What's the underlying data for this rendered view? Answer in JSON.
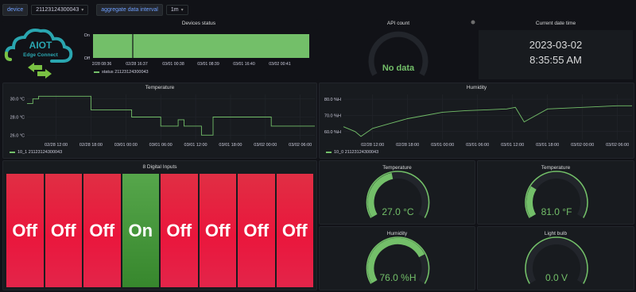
{
  "toolbar": {
    "device_label": "device",
    "device_value": "21123124300043",
    "interval_label": "aggregate data interval",
    "interval_value": "1m"
  },
  "logo": {
    "line1": "AIOT",
    "line2": "Edge Connect"
  },
  "devices_status": {
    "title": "Devices status",
    "y_top": "On",
    "y_bottom": "Off",
    "x_ticks": [
      "2/28 08:36",
      "02/28 16:37",
      "03/01 00:38",
      "03/01 08:39",
      "03/01 16:40",
      "03/02 00:41"
    ],
    "legend": "status 21123124300043",
    "chart_data": {
      "type": "bar",
      "title": "Devices status",
      "categories": [
        "2/28 08:36",
        "02/28 16:37",
        "03/01 00:38",
        "03/01 08:39",
        "03/01 16:40",
        "03/02 00:41"
      ],
      "series": [
        {
          "name": "status 21123124300043",
          "values": [
            1,
            1,
            1,
            1,
            1,
            1
          ]
        }
      ],
      "ylim": [
        0,
        1
      ]
    }
  },
  "api_count": {
    "title": "API count",
    "value": "No data"
  },
  "clock": {
    "title": "Current date time",
    "date": "2023-03-02",
    "time": "8:35:55 AM"
  },
  "temperature_chart": {
    "title": "Temperature",
    "y_ticks": [
      "30.0 °C",
      "28.0 °C",
      "26.0 °C"
    ],
    "x_ticks": [
      "02/28 12:00",
      "02/28 18:00",
      "03/01 00:00",
      "03/01 06:00",
      "03/01 12:00",
      "03/01 18:00",
      "03/02 00:00",
      "03/02 06:00"
    ],
    "legend": "10_1 21123124300043",
    "chart_data": {
      "type": "line",
      "title": "Temperature",
      "ylabel": "°C",
      "ylim": [
        25.5,
        30.5
      ],
      "x": [
        "02/28 07:00",
        "02/28 08:00",
        "02/28 09:00",
        "02/28 12:00",
        "02/28 16:00",
        "02/28 18:00",
        "02/28 19:00",
        "02/28 22:00",
        "03/01 00:00",
        "03/01 01:00",
        "03/01 03:00",
        "03/01 06:00",
        "03/01 07:30",
        "03/01 09:00",
        "03/01 10:00",
        "03/01 11:30",
        "03/01 13:00",
        "03/01 15:00",
        "03/01 18:00",
        "03/01 22:00",
        "03/02 01:00",
        "03/02 08:30"
      ],
      "series": [
        {
          "name": "10_1 21123124300043",
          "values": [
            29.5,
            30.0,
            30.3,
            30.3,
            30.3,
            28.8,
            28.8,
            28.8,
            28.8,
            28.0,
            28.0,
            27.0,
            27.0,
            27.7,
            27.0,
            27.0,
            26.0,
            28.0,
            28.0,
            28.0,
            27.0,
            27.0
          ]
        }
      ]
    }
  },
  "humidity_chart": {
    "title": "Humidity",
    "y_ticks": [
      "80.0 %H",
      "70.0 %H",
      "60.0 %H"
    ],
    "x_ticks": [
      "02/28 12:00",
      "02/28 18:00",
      "03/01 00:00",
      "03/01 06:00",
      "03/01 12:00",
      "03/01 18:00",
      "03/02 00:00",
      "03/02 06:00"
    ],
    "legend": "10_0 21123124300043",
    "chart_data": {
      "type": "line",
      "title": "Humidity",
      "ylabel": "%H",
      "ylim": [
        55,
        83
      ],
      "x": [
        "02/28 07:00",
        "02/28 09:00",
        "02/28 10:00",
        "02/28 12:00",
        "02/28 15:00",
        "02/28 18:00",
        "02/28 21:00",
        "03/01 00:00",
        "03/01 04:00",
        "03/01 08:00",
        "03/01 11:00",
        "03/01 12:30",
        "03/01 14:00",
        "03/01 18:00",
        "03/02 00:00",
        "03/02 06:00",
        "03/02 08:30"
      ],
      "series": [
        {
          "name": "10_0 21123124300043",
          "values": [
            63,
            60,
            57,
            62,
            65,
            68,
            70,
            72,
            73,
            73.5,
            74,
            75,
            66,
            74,
            75,
            76,
            76
          ]
        }
      ]
    }
  },
  "digital_inputs": {
    "title": "8 Digital Inputs",
    "items": [
      "Off",
      "Off",
      "Off",
      "On",
      "Off",
      "Off",
      "Off",
      "Off"
    ]
  },
  "gauge_temp_c": {
    "title": "Temperature",
    "value": "27.0 °C",
    "fraction": 0.45
  },
  "gauge_temp_f": {
    "title": "Temperature",
    "value": "81.0 °F",
    "fraction": 0.26
  },
  "gauge_humidity": {
    "title": "Humidity",
    "value": "76.0 %H",
    "fraction": 0.76
  },
  "gauge_light": {
    "title": "Light bulb",
    "value": "0.0 V",
    "fraction": 0
  },
  "colors": {
    "green": "#73bf69",
    "red": "#e02f44",
    "track": "#22252b",
    "background": "#111217",
    "panel": "#181b1f"
  }
}
